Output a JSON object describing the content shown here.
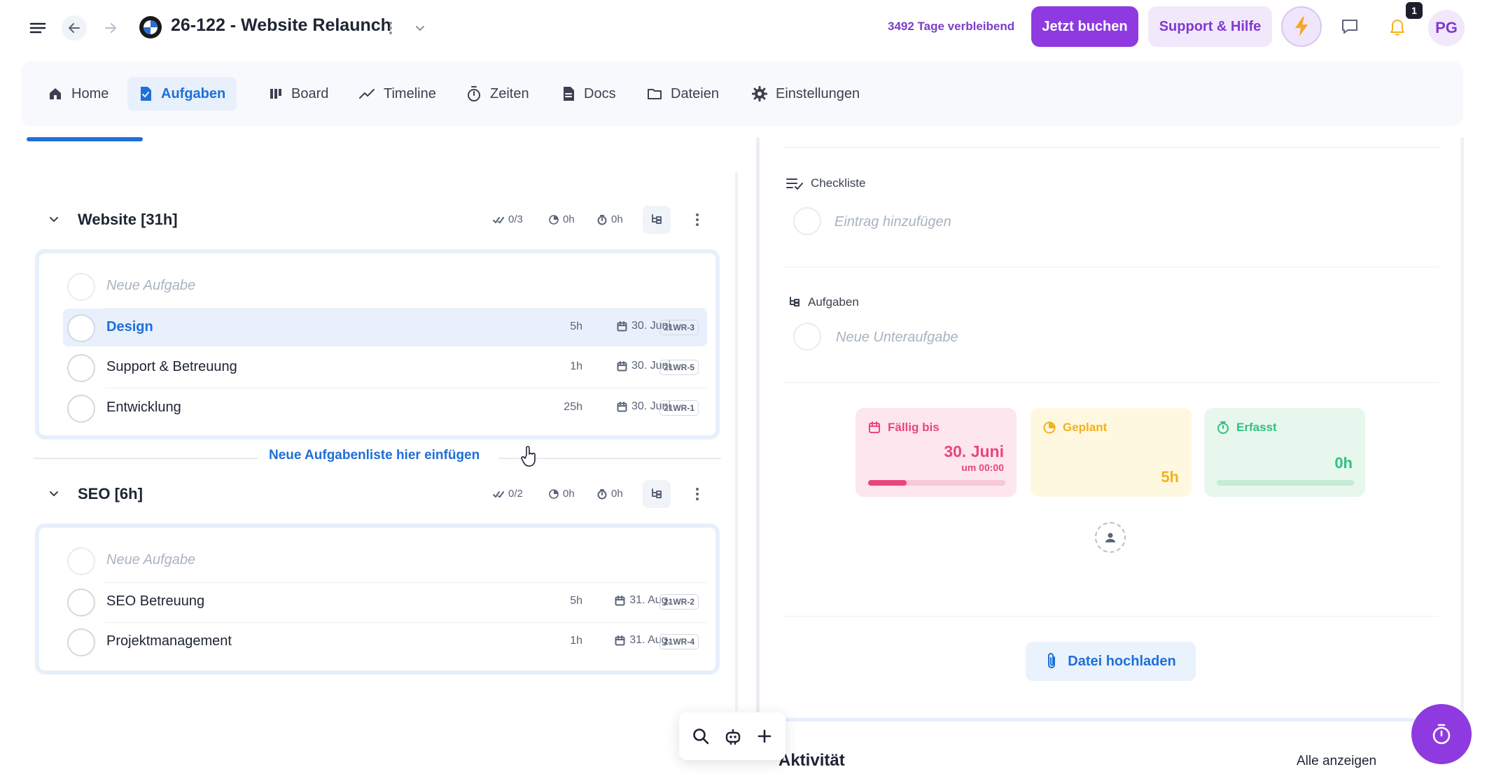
{
  "header": {
    "project_title": "26-122 - Website Relaunch",
    "days_left": "3492 Tage verbleibend",
    "book_label": "Jetzt buchen",
    "support_label": "Support & Hilfe",
    "notification_count": "1",
    "avatar_initials": "PG"
  },
  "nav": {
    "tabs": [
      {
        "label": "Home",
        "icon": "home-icon"
      },
      {
        "label": "Aufgaben",
        "icon": "document-icon",
        "active": true
      },
      {
        "label": "Board",
        "icon": "columns-icon"
      },
      {
        "label": "Timeline",
        "icon": "chart-line-icon"
      },
      {
        "label": "Zeiten",
        "icon": "stopwatch-icon"
      },
      {
        "label": "Docs",
        "icon": "file-text-icon"
      },
      {
        "label": "Dateien",
        "icon": "folder-icon"
      },
      {
        "label": "Einstellungen",
        "icon": "gear-icon"
      }
    ]
  },
  "groups": [
    {
      "title": "Website [31h]",
      "done": "0/3",
      "planned": "0h",
      "tracked": "0h",
      "new_task_placeholder": "Neue Aufgabe",
      "tasks": [
        {
          "name": "Design",
          "hours": "5h",
          "date": "30. Juni",
          "code": "21WR-3",
          "selected": true
        },
        {
          "name": "Support & Betreuung",
          "hours": "1h",
          "date": "30. Juni",
          "code": "21WR-5"
        },
        {
          "name": "Entwicklung",
          "hours": "25h",
          "date": "30. Juni",
          "code": "21WR-1"
        }
      ]
    },
    {
      "title": "SEO [6h]",
      "done": "0/2",
      "planned": "0h",
      "tracked": "0h",
      "new_task_placeholder": "Neue Aufgabe",
      "tasks": [
        {
          "name": "SEO Betreuung",
          "hours": "5h",
          "date": "31. Aug.",
          "code": "21WR-2"
        },
        {
          "name": "Projektmanagement",
          "hours": "1h",
          "date": "31. Aug.",
          "code": "21WR-4"
        }
      ]
    }
  ],
  "insert_list_label": "Neue Aufgabenliste hier einfügen",
  "detail": {
    "checklist_label": "Checkliste",
    "checklist_placeholder": "Eintrag hinzufügen",
    "subtasks_label": "Aufgaben",
    "subtask_placeholder": "Neue Unteraufgabe",
    "due": {
      "label": "Fällig bis",
      "date": "30. Juni",
      "time": "um 00:00",
      "progress": 0.28,
      "color": "#e8467c"
    },
    "planned": {
      "label": "Geplant",
      "value": "5h",
      "color": "#f2b21b"
    },
    "tracked": {
      "label": "Erfasst",
      "value": "0h",
      "progress": 0.0,
      "color": "#2ec27e"
    },
    "upload_label": "Datei hochladen",
    "activity_label": "Aktivität",
    "show_all_label": "Alle anzeigen"
  },
  "colors": {
    "accent": "#8e3ae0",
    "primary": "#1f6fd9"
  }
}
